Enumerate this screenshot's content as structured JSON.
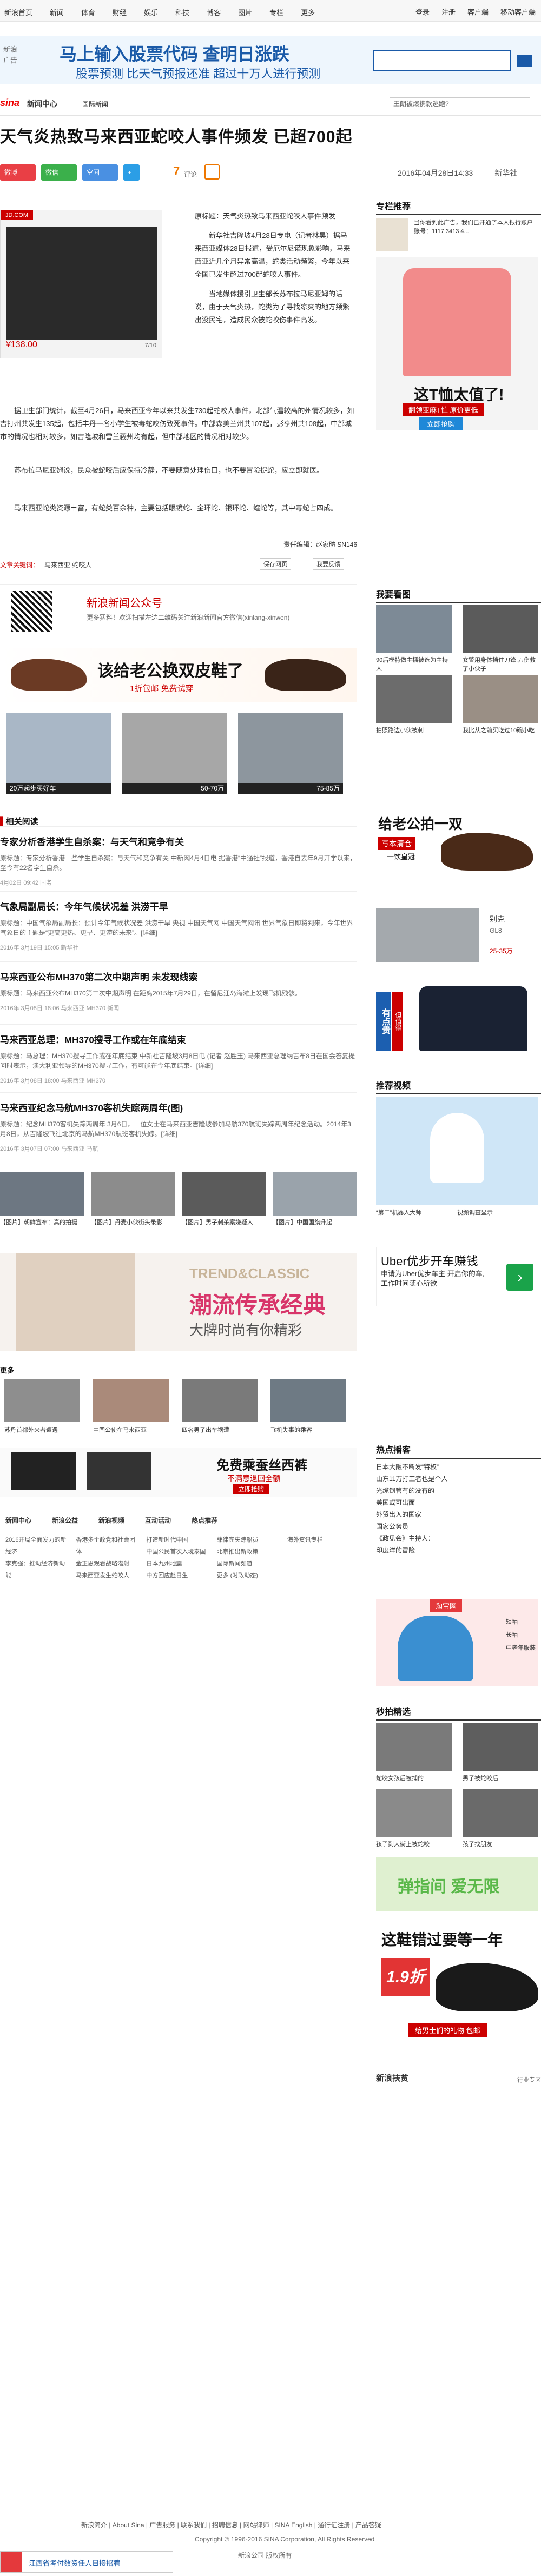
{
  "topnav": {
    "links": [
      "新浪首页",
      "新闻",
      "体育",
      "财经",
      "娱乐",
      "科技",
      "博客",
      "图片",
      "专栏",
      "更多"
    ],
    "right": [
      "登录",
      "注册",
      "客户端",
      "移动客户端"
    ]
  },
  "ad": {
    "label": "新浪广告",
    "big": "马上输入股票代码  查明日涨跌",
    "small": "股票预测 比天气预报还准 超过十万人进行预测",
    "placeholder": ""
  },
  "channel": {
    "logo": "sina",
    "logo2": "新闻中心",
    "sub": "国际新闻",
    "search": "王朗被爆携款逃跑?"
  },
  "article": {
    "title": "天气炎热致马来西亚蛇咬人事件频发 已超700起",
    "date": "2016年04月28日14:33",
    "source": "新华社",
    "comments": "7",
    "price": "¥138.00",
    "counter": "7/10",
    "p1": "原标题：天气炎热致马来西亚蛇咬人事件频发",
    "p2": "新华社吉隆坡4月28日专电（记者林昊）据马来西亚媒体28日报道，受厄尔尼诺现象影响，马来西亚近几个月异常高温，蛇类活动频繁，今年以来全国已发生超过700起蛇咬人事件。",
    "p3": "当地媒体援引卫生部长苏布拉马尼亚姆的话说，由于天气炎热，蛇类为了寻找凉爽的地方频繁出没民宅，造成民众被蛇咬伤事件高发。",
    "p4": "据卫生部门统计，截至4月26日，马来西亚今年以来共发生730起蛇咬人事件，北部气温较高的州情况较多，如吉打州共发生135起，包括丰丹一名小学生被毒蛇咬伤致死事件。中部森美兰州共107起，彭亨州共108起，中部城市的情况也相对较多，如吉隆坡和雪兰莪州均有起，但中部地区的情况相对较少。",
    "p5": "苏布拉马尼亚姆说，民众被蛇咬后应保持冷静，不要随意处理伤口，也不要冒险捉蛇，应立即就医。",
    "p6": "马来西亚蛇类资源丰富，有蛇类百余种，主要包括眼镜蛇、金环蛇、银环蛇、蝰蛇等，其中毒蛇占四成。",
    "editor": "责任编辑：赵家昉 SN146",
    "tags_label": "文章关键词：",
    "tag": "马来西亚 蛇咬人",
    "save": "保存网页",
    "report": "我要反馈"
  },
  "qr": {
    "title": "新浪新闻公众号",
    "desc": "更多猛料！欢迎扫描左边二维码关注新浪新闻官方微信(xinlang-xinwen)"
  },
  "shoeAd": {
    "text": "该给老公换双皮鞋了",
    "sub": "1折包邮 免费试穿"
  },
  "cars": [
    {
      "name": "20万起步买好车"
    },
    {
      "name": "",
      "p": "25-35万"
    },
    {
      "name": "",
      "p": "50-70万"
    },
    {
      "name": "",
      "p": "75-85万"
    }
  ],
  "related": {
    "heading": "相关阅读",
    "items": [
      {
        "t": "专家分析香港学生自杀案：与天气和竞争有关",
        "d": "原标题：专家分析香港一些学生自杀案：与天气和竞争有关 中新网4月4日电 据香港“中通社”报道，香港自去年9月开学以来，至今有22名学生自杀。",
        "m": "4月02日 09:42  国务"
      },
      {
        "t": "气象局副局长：今年气候状况差 洪涝干旱",
        "d": "原标题：中国气象局副局长：预计今年气候状况差 洪涝干旱 央视 中国天气网 中国天气网讯 世界气象日即将到来，今年世界气象日的主题是“更高更热、更旱、更涝的未来”。[详细]",
        "m": "2016年 3月19日 15:05  新华社"
      },
      {
        "t": "马来西亚公布MH370第二次中期声明 未发现线索",
        "d": "原标题：马来西亚公布MH370第二次中期声明 在距离2015年7月29日，在留尼汪岛海滩上发现飞机残骸。",
        "m": "2016年 3月08日 18:06  马来西亚  MH370  新闻"
      },
      {
        "t": "马来西亚总理：MH370搜寻工作或在年底结束",
        "d": "原标题：马总理：MH370搜寻工作或在年底结束 中新社吉隆坡3月8日电 (记者 赵胜玉) 马来西亚总理纳吉布8日在国会答复提问时表示，澳大利亚领导的MH370搜寻工作，有可能在今年底结束。[详细]",
        "m": "2016年 3月08日 18:00  马来西亚  MH370"
      },
      {
        "t": "马来西亚纪念马航MH370客机失踪两周年(图)",
        "d": "原标题：纪念MH370客机失踪两周年 3月6日，一位女士在马来西亚吉隆坡参加马航370航班失踪两周年纪念活动。2014年3月8日，从吉隆坡飞往北京的马航MH370航班客机失踪。[详细]",
        "m": "2016年 3月07日 07:00  马来西亚  马航"
      }
    ]
  },
  "thumbs1": [
    "【图片】朝鲜宣布：真的拍摄",
    "【图片】丹麦小伙街头录影",
    "【图片】男子刺杀案嫌疑人",
    "【图片】中国国旗升起"
  ],
  "fashion": {
    "t1": "TREND&CLASSIC",
    "t2": "潮流传承经典",
    "t3": "大牌时尚有你精彩"
  },
  "more": {
    "heading": "更多",
    "items": [
      "苏丹首都外来者遭遇",
      "中国公使在马来西亚",
      "四名男子出车祸遭",
      "飞机失事的乘客"
    ]
  },
  "belt": {
    "t1": "免费乘蚕丝西裤",
    "t2": "不满意退回全额",
    "btn": "立即抢购"
  },
  "tabs": {
    "items": [
      "新闻中心",
      "新浪公益",
      "新浪视频",
      "互动活动",
      "热点推荐"
    ]
  },
  "links": [
    "2016开局全面发力的新经济",
    "李克强：推动经济新动能",
    "香港多个政党和社会团体",
    "金正恩观看战略潜射",
    "马来西亚发生蛇咬人",
    "打造新时代中国",
    "中国公民首次入境泰国",
    "日本九州地震",
    "中方回应赴日生",
    "菲律宾失踪船员",
    "北京推出新政策",
    "国际新闻频道",
    "更多 (时政动态)",
    "海外资讯专栏"
  ],
  "sidebar": {
    "zhuanke": "专栏推荐",
    "bankAd": "当你看到此广告，我们已开通了本人银行账户账号：1117 3413 4...",
    "polo": {
      "t": "这T恤太值了!",
      "t2": "翻领亚麻T恤 原价更低",
      "t3": "立即抢购"
    },
    "watch": "我要看图",
    "pics": [
      {
        "c": "90后模特做主播被选为主持人"
      },
      {
        "c": "女警用身体挡住刀锋,刀伤救了小伙子"
      },
      {
        "c": "拍照路边小伙被刺"
      },
      {
        "c": "我比从之前买吃过10碗小吃"
      }
    ],
    "shoe2": {
      "t": "给老公拍一双",
      "t2": "写本清仓",
      "t3": "一饮皇冠"
    },
    "car": {
      "n": "别克",
      "s": "GL8",
      "p": "25-35万"
    },
    "tshirt": {
      "t": "有点贵",
      "t2": "但值得"
    },
    "video": "推荐视频",
    "vcap1": "“第二”机器人大师",
    "vcap2": "视频调查显示",
    "uber": {
      "t": "Uber优步开车赚钱",
      "s": "申请为Uber优步车主 开启你的车,工作时间随心所欲"
    },
    "hot": "热点播客",
    "hotlist": [
      "日本大阪不断发“特权”",
      "山东11万打工者也是个人",
      "光缆钢管有的没有的",
      "美国或可出面",
      "外贸出入的国家",
      "国家公务员",
      "《政见会》主持人：",
      "印度洋的冒险"
    ],
    "taobao": {
      "brand": "淘宝网",
      "i": [
        "短袖",
        "长袖",
        "中老年服装"
      ]
    },
    "miaopai": "秒拍精选",
    "mp": [
      "蛇咬女孩后被捕的",
      "男子被蛇咬后",
      "孩子到大街上被蛇咬",
      "孩子找朋友"
    ],
    "banner": "弹指间 爱无限",
    "shoe3": {
      "t": "这鞋错过要等一年",
      "p": "1.9折",
      "s": "给男士们的礼物 包邮"
    },
    "more": "新浪扶贫",
    "more2": "行业专区"
  },
  "footer": {
    "links": "新浪简介  |  About Sina  |  广告服务  |  联系我们  |  招聘信息  |  网站律师  |  SINA English  |  通行证注册  |  产品答疑",
    "cp": "Copyright © 1996-2016 SINA Corporation, All Rights Reserved",
    "cp2": "新浪公司 版权所有"
  },
  "bottomAd": "江西省考付数资任人日接招聘"
}
